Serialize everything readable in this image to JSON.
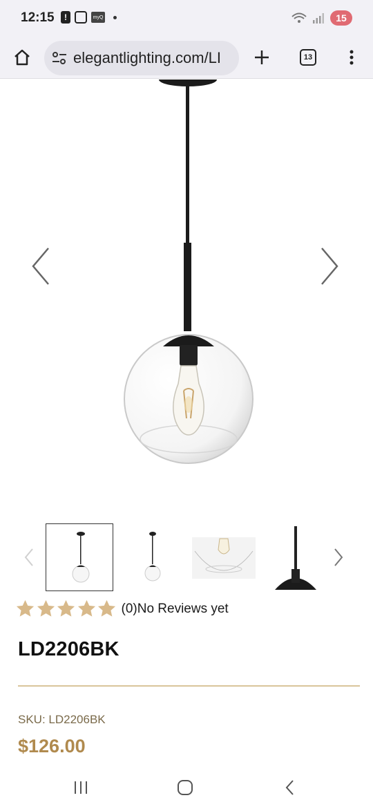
{
  "status_bar": {
    "time": "12:15",
    "myq_label": "myQ",
    "battery": "15"
  },
  "browser": {
    "url": "elegantlighting.com/LI",
    "tab_count": "13"
  },
  "product": {
    "rating_text": "(0)No Reviews yet",
    "stars": 5,
    "title": "LD2206BK",
    "sku": "SKU: LD2206BK",
    "price": "$126.00"
  },
  "colors": {
    "star": "#d8b98a",
    "divider": "#d9c49a",
    "price": "#b08a4e",
    "battery": "#e06a72"
  }
}
